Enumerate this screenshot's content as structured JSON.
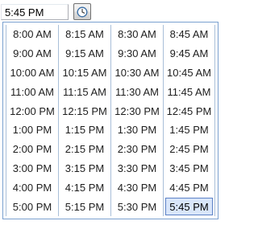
{
  "time_input": {
    "value": "5:45 PM"
  },
  "picker_button": {
    "icon": "clock-icon"
  },
  "selected_time": "5:45 PM",
  "columns": [
    [
      "8:00 AM",
      "9:00 AM",
      "10:00 AM",
      "11:00 AM",
      "12:00 PM",
      "1:00 PM",
      "2:00 PM",
      "3:00 PM",
      "4:00 PM",
      "5:00 PM"
    ],
    [
      "8:15 AM",
      "9:15 AM",
      "10:15 AM",
      "11:15 AM",
      "12:15 PM",
      "1:15 PM",
      "2:15 PM",
      "3:15 PM",
      "4:15 PM",
      "5:15 PM"
    ],
    [
      "8:30 AM",
      "9:30 AM",
      "10:30 AM",
      "11:30 AM",
      "12:30 PM",
      "1:30 PM",
      "2:30 PM",
      "3:30 PM",
      "4:30 PM",
      "5:30 PM"
    ],
    [
      "8:45 AM",
      "9:45 AM",
      "10:45 AM",
      "11:45 AM",
      "12:45 PM",
      "1:45 PM",
      "2:45 PM",
      "3:45 PM",
      "4:45 PM",
      "5:45 PM"
    ]
  ],
  "colors": {
    "dropdown_border": "#7aa0cf",
    "column_divider": "#a9bfd9",
    "selected_background": "#d9e6fa",
    "selected_border": "#5d82c6"
  }
}
